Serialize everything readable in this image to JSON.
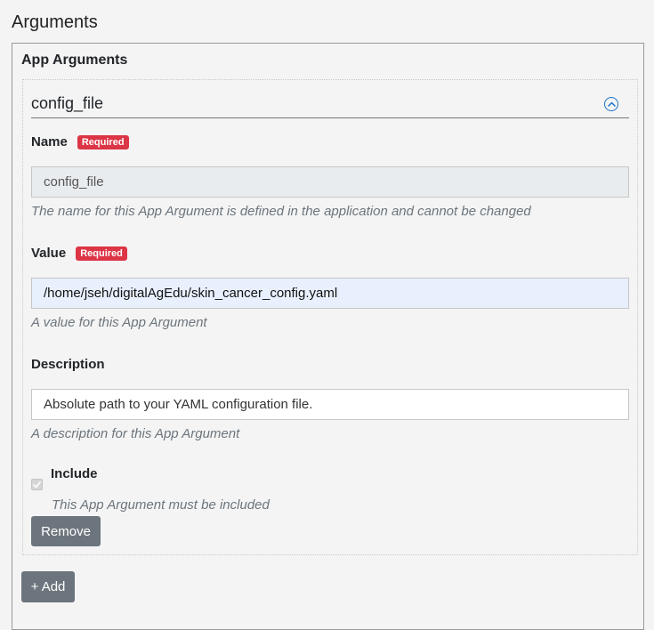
{
  "section": {
    "title": "Arguments"
  },
  "app_arguments": {
    "heading": "App Arguments",
    "add_label": "+ Add",
    "argument": {
      "header_title": "config_file",
      "collapse_icon": "chevron-up-circle-icon",
      "name": {
        "label": "Name",
        "badge": "Required",
        "value": "config_file",
        "help": "The name for this App Argument is defined in the application and cannot be changed"
      },
      "value": {
        "label": "Value",
        "badge": "Required",
        "value": "/home/jseh/digitalAgEdu/skin_cancer_config.yaml",
        "help": "A value for this App Argument"
      },
      "description": {
        "label": "Description",
        "value": "Absolute path to your YAML configuration file.",
        "help": "A description for this App Argument"
      },
      "include": {
        "label": "Include",
        "checked": true,
        "disabled": true,
        "help": "This App Argument must be included"
      },
      "remove_label": "Remove"
    }
  },
  "colors": {
    "badge_required": "#dc3545",
    "button_secondary": "#6c757d",
    "accent_icon": "#1a73c8",
    "autofill_bg": "#e8f0fe",
    "readonly_bg": "#e9ecef"
  }
}
